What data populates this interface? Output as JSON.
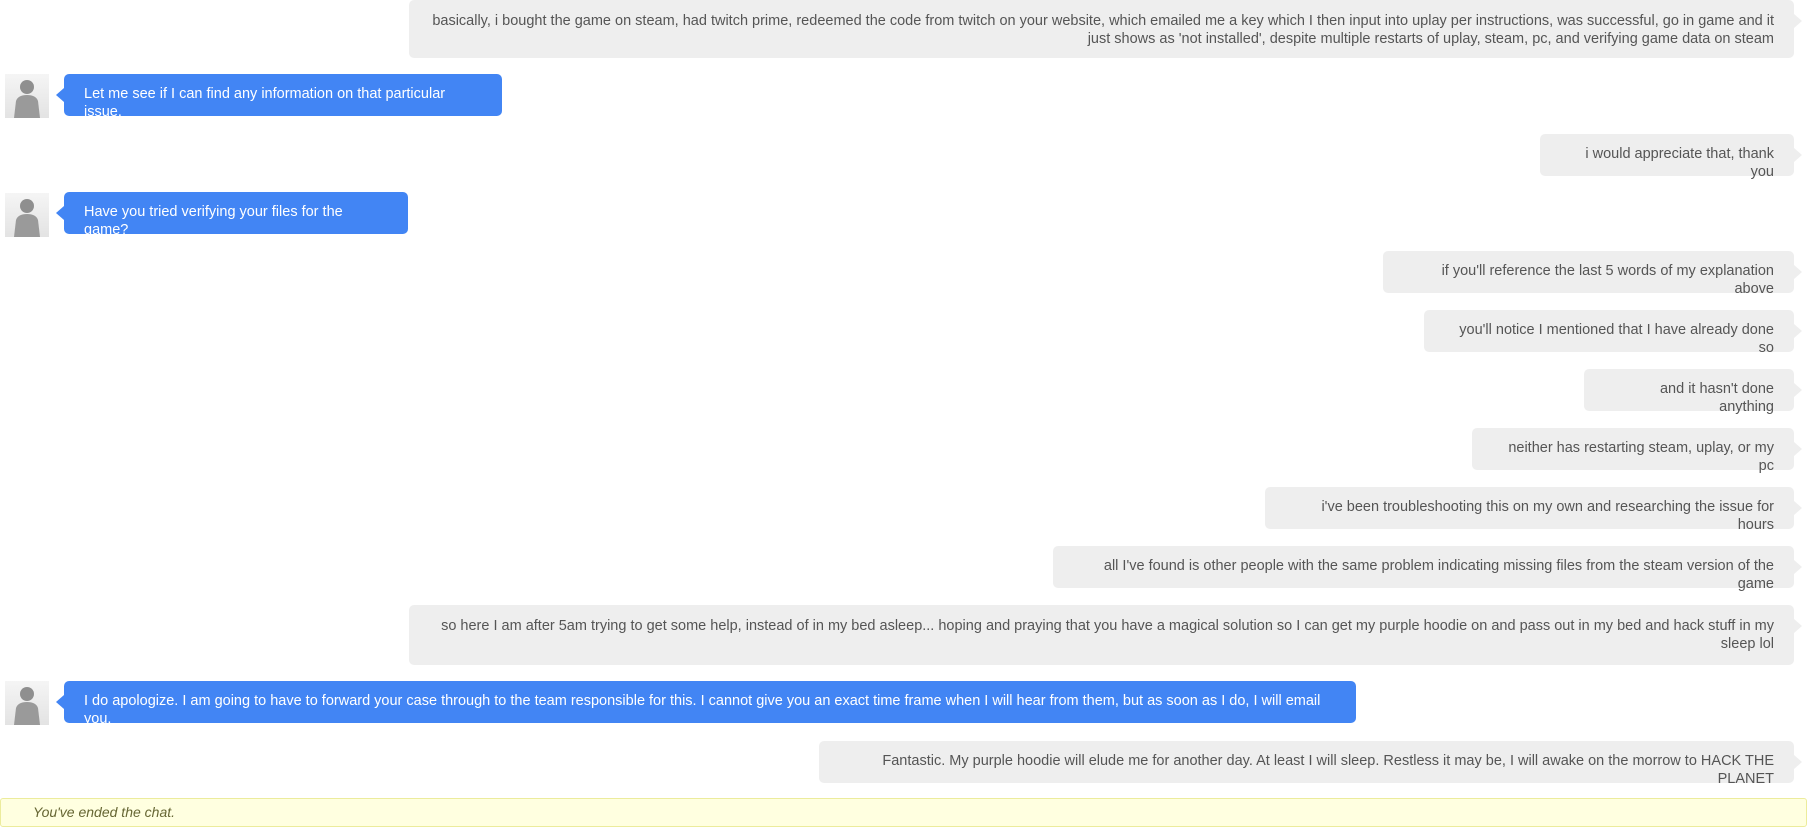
{
  "conversation": {
    "messages": [
      {
        "sender": "user",
        "text": "basically, i bought the game on steam, had twitch prime, redeemed the code from twitch on your website, which emailed me a key which I then input into uplay per instructions, was successful, go in game and it just shows as 'not installed', despite multiple restarts of uplay, steam, pc, and verifying game data on steam"
      },
      {
        "sender": "agent",
        "text": "Let me see if I can find any information on that particular issue."
      },
      {
        "sender": "user",
        "text": "i would appreciate that, thank you"
      },
      {
        "sender": "agent",
        "text": "Have you tried verifying your files for the game?"
      },
      {
        "sender": "user",
        "text": "if you'll reference the last 5 words of my explanation above"
      },
      {
        "sender": "user",
        "text": "you'll notice I mentioned that I have already done so"
      },
      {
        "sender": "user",
        "text": "and it hasn't done anything"
      },
      {
        "sender": "user",
        "text": "neither has restarting steam, uplay, or my pc"
      },
      {
        "sender": "user",
        "text": "i've been troubleshooting this on my own and researching the issue for hours"
      },
      {
        "sender": "user",
        "text": "all I've found is other people with the same problem indicating missing files from the steam version of the game"
      },
      {
        "sender": "user",
        "text": "so here I am after 5am trying to get some help, instead of in my bed asleep... hoping and praying that you have a magical solution so I can get my purple hoodie on and pass out in my bed and hack stuff in my sleep lol"
      },
      {
        "sender": "agent",
        "text": "I do apologize. I am going to have to forward your case through to the team responsible for this. I cannot give you an exact time frame when I will hear from them, but as soon as I do, I will email you."
      },
      {
        "sender": "user",
        "text": "Fantastic. My purple hoodie will elude me for another day. At least I will sleep. Restless it may be, I will awake on the morrow to HACK THE PLANET"
      }
    ]
  },
  "status": {
    "text": "You've ended the chat."
  },
  "colors": {
    "agent_bubble": "#4285f4",
    "user_bubble": "#eeeeee",
    "status_background": "#ffffe0"
  },
  "icons": {
    "agent_avatar": "agent-avatar-silhouette-icon"
  }
}
